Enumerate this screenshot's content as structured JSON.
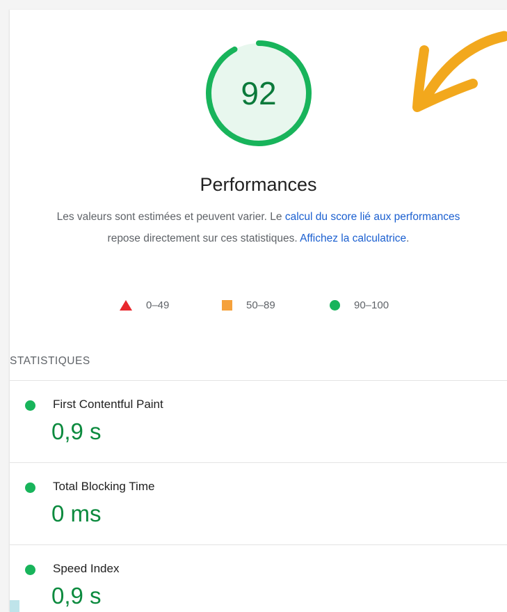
{
  "score": {
    "value": "92",
    "fraction": 0.92,
    "ring_color": "#18b45b",
    "fill_color": "#e8f7ee",
    "text_color": "#0b7a3b"
  },
  "title": "Performances",
  "description": {
    "part1": "Les valeurs sont estimées et peuvent varier. Le ",
    "link1": "calcul du score lié aux performances",
    "part2": " repose directement sur ces statistiques. ",
    "link2": "Affichez la calculatrice",
    "part3": "."
  },
  "legend": [
    {
      "icon": "triangle-icon",
      "range": "0–49",
      "color": "#e8282d"
    },
    {
      "icon": "square-icon",
      "range": "50–89",
      "color": "#f5a13b"
    },
    {
      "icon": "circle-icon",
      "range": "90–100",
      "color": "#18b45b"
    }
  ],
  "section_title": "STATISTIQUES",
  "metrics": [
    {
      "label": "First Contentful Paint",
      "value": "0,9 s"
    },
    {
      "label": "Total Blocking Time",
      "value": "0 ms"
    },
    {
      "label": "Speed Index",
      "value": "0,9 s"
    }
  ],
  "annotation": {
    "icon": "hand-drawn-arrow-icon",
    "color": "#f2a81d"
  }
}
